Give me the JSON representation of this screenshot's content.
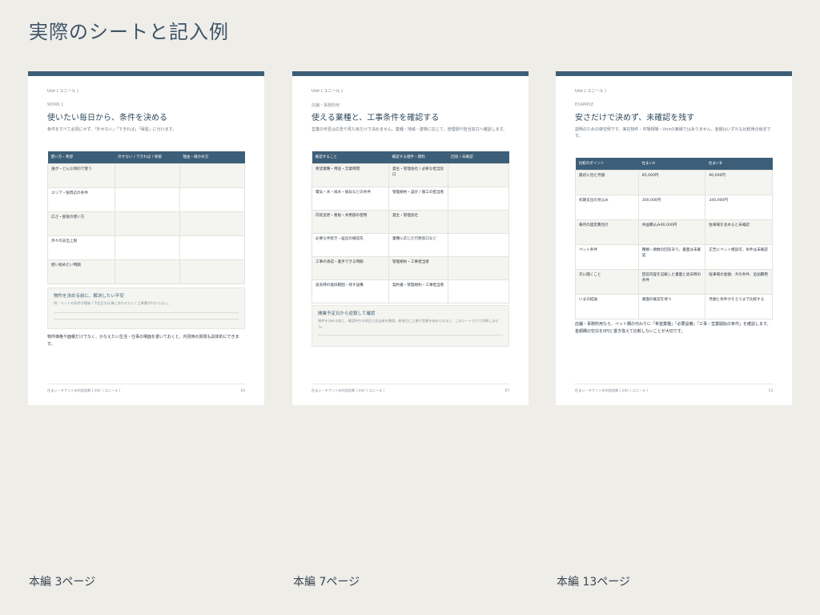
{
  "title": "実際のシートと記入例",
  "sheets": [
    {
      "brand": "Unir ( ユニール )",
      "kicker": "WORK 1",
      "heading": "使いたい毎日から、条件を決める",
      "lead": "条件をすべて必須にせず、「外せない」「できれば」「保留」に分けます。",
      "headers": [
        "使い方・希望",
        "外せない / できれば / 保留",
        "理由・確かめ方"
      ],
      "rows": [
        [
          "誰が・どんな目的で使う",
          "",
          ""
        ],
        [
          "エリア・駅周辺の条件",
          "",
          ""
        ],
        [
          "広さ・部屋の使い方",
          "",
          ""
        ],
        [
          "月々の支出上限",
          "",
          ""
        ],
        [
          "使い始めたい時期",
          "",
          ""
        ]
      ],
      "note_title": "物件を決める前に、解決したい不安",
      "note_text": "例：ペットの条件が曖昧 / 予定日を仕事に合わせたい / 工事費がわからない。",
      "after": "物件価格や面積だけでなく、かなえたい生活・仕事の場面を書いておくと、内見時の質問も具体的にできます。",
      "footer": "住まい・テナントの内見診断 | Unir ( ユニール )",
      "page_no": "03"
    },
    {
      "brand": "Unir ( ユニール )",
      "kicker": "店舗・事務所用",
      "heading": "使える業種と、工事条件を確認する",
      "lead": "営業の可否は広告や見た目だけで決めません。業種・地域・建物に応じて、管理側や担当窓口へ確認します。",
      "headers": [
        "確認すること",
        "確認する相手・資料",
        "回答 / 未確認"
      ],
      "rows": [
        [
          "希望業種・用途・営業時間",
          "貸主・管理会社 / 必要な担当窓口",
          ""
        ],
        [
          "電気・水・排水・換気などの条件",
          "管理規約・設計 / 施工の担当者",
          ""
        ],
        [
          "内装変更・看板・共用部の使用",
          "貸主・管理会社",
          ""
        ],
        [
          "必要な手続き・届出の確認先",
          "業種に応じた行政窓口など",
          ""
        ],
        [
          "工事の承認・着手できる時期",
          "管理規約・工事担当者",
          ""
        ],
        [
          "退去時の復旧範囲・残す設備",
          "契約書・管理規約・工事担当者",
          ""
        ]
      ],
      "note_title": "開業予定日から逆算して確認",
      "note_text": "物件を決める前に、確認待ちの項目と担当者を整理。希望日に工事や営業を始められると、このシートだけで判断しません。",
      "after": "",
      "footer": "住まい・テナントの内見診断 | Unir ( ユニール )",
      "page_no": "07"
    },
    {
      "brand": "Unir ( ユニール )",
      "kicker": "EXAMPLE",
      "heading": "安さだけで決めず、未確認を残す",
      "lead": "説明のための架空例です。実在物件・市場相場・Unirの実績ではありません。金額はいずれも比較用の仮定です。",
      "headers": [
        "比較のポイント",
        "住まいA",
        "住まいB"
      ],
      "rows": [
        [
          "最初に見た月額",
          "85,000円",
          "90,000円"
        ],
        [
          "初期支出の見込み",
          "300,000円",
          "340,000円"
        ],
        [
          "毎月の固定費合計",
          "共益費込み90,000円",
          "駐車場を含めると未確認"
        ],
        [
          "ペット条件",
          "種類・頭数の回答あり。書面は未確認",
          "広告にペット相談可。条件は未確認"
        ],
        [
          "次に聞くこと",
          "回答内容を記載した書面と退去時の条件",
          "駐車場の金額、犬の条件、追加費用"
        ],
        [
          "いまの結論",
          "書面の確認を待つ",
          "月額と条件がそろうまで比較する"
        ]
      ],
      "note_title": "",
      "note_text": "",
      "after": "店舗・事務所用なら、ペット欄の代わりに「希望業種」「必要設備」「工事・営業開始の条件」を確認します。金額欄の空白を0円と置き換えて比較しないことが大切です。",
      "footer": "住まい・テナントの内見診断 | Unir ( ユニール )",
      "page_no": "13"
    }
  ],
  "captions": [
    "本編 3ページ",
    "本編 7ページ",
    "本編 13ページ"
  ]
}
